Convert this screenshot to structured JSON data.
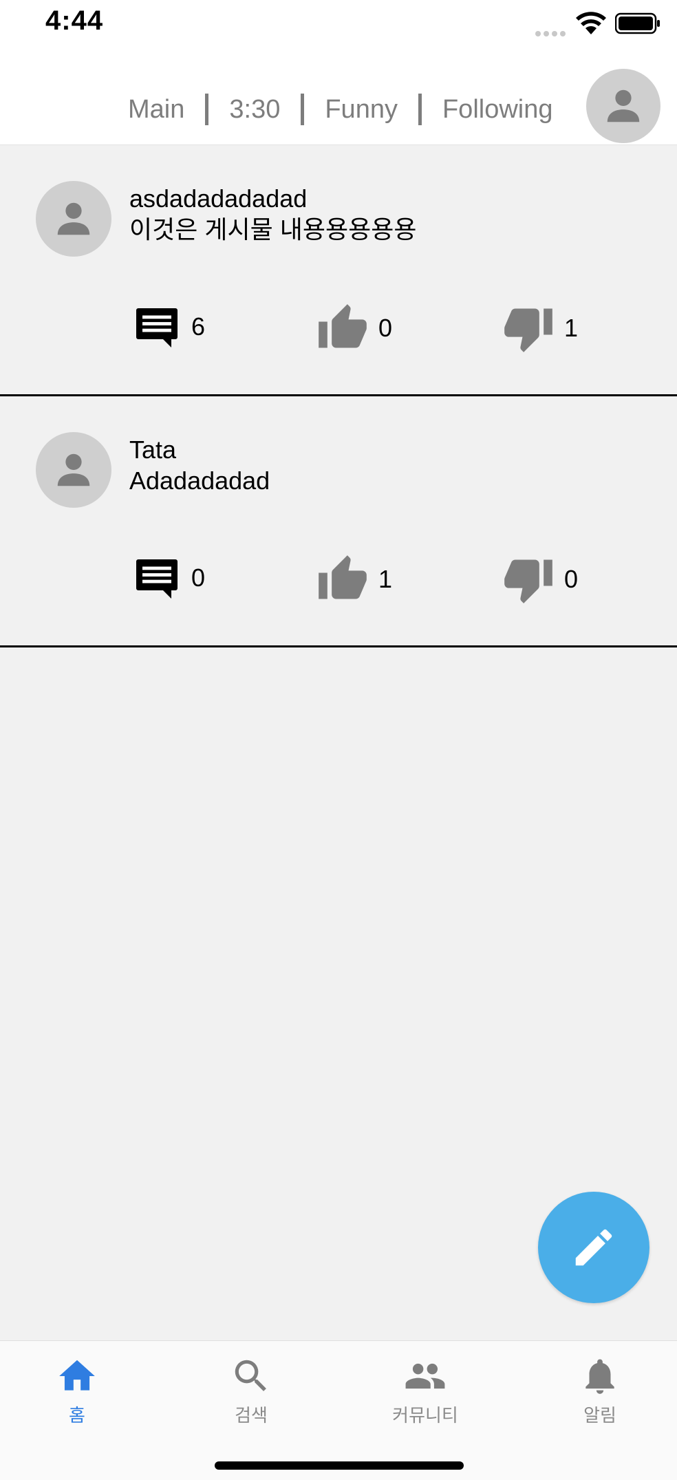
{
  "status_bar": {
    "time": "4:44"
  },
  "header": {
    "tabs": [
      "Main",
      "3:30",
      "Funny",
      "Following"
    ],
    "profile_icon": "person-icon"
  },
  "posts": [
    {
      "author": "asdadadadadad",
      "content": "이것은 게시물 내용용용용용",
      "comments": "6",
      "likes": "0",
      "dislikes": "1"
    },
    {
      "author": "Tata",
      "content": "Adadadadad",
      "comments": "0",
      "likes": "1",
      "dislikes": "0"
    }
  ],
  "fab": {
    "icon": "pencil-icon"
  },
  "bottom_nav": {
    "items": [
      {
        "label": "홈",
        "icon": "home-icon",
        "active": true
      },
      {
        "label": "검색",
        "icon": "search-icon",
        "active": false
      },
      {
        "label": "커뮤니티",
        "icon": "people-icon",
        "active": false
      },
      {
        "label": "알림",
        "icon": "bell-icon",
        "active": false
      }
    ]
  },
  "colors": {
    "accent": "#2f7de1",
    "fab": "#4aaee8",
    "icon_gray": "#7d7d7d",
    "background": "#f1f1f1"
  }
}
